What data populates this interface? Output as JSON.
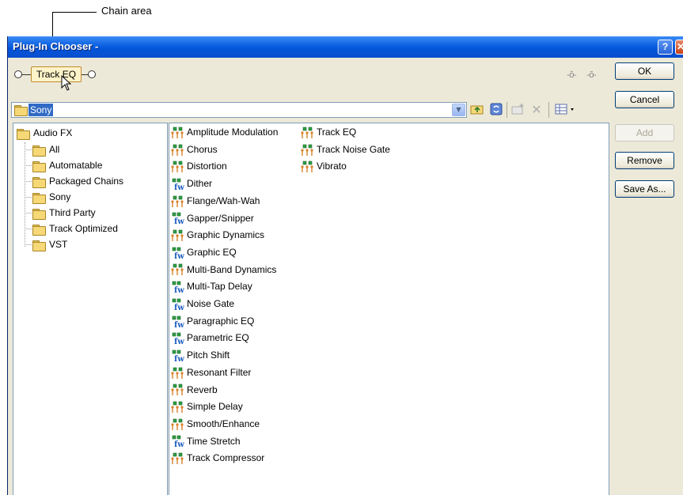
{
  "callout": {
    "text": "Chain area"
  },
  "window": {
    "title": "Plug-In Chooser -",
    "help_glyph": "?",
    "close_glyph": "✕"
  },
  "chain": {
    "item_label": "Track EQ"
  },
  "folder_selector": {
    "value": "Sony"
  },
  "buttons": {
    "ok": "OK",
    "cancel": "Cancel",
    "add": "Add",
    "remove": "Remove",
    "save_as": "Save As..."
  },
  "tree": {
    "root": "Audio FX",
    "children": [
      "All",
      "Automatable",
      "Packaged Chains",
      "Sony",
      "Third Party",
      "Track Optimized",
      "VST"
    ]
  },
  "plugins": [
    {
      "name": "Amplitude Modulation",
      "icon": "plugin-chain-icon"
    },
    {
      "name": "Chorus",
      "icon": "plugin-chain-icon"
    },
    {
      "name": "Distortion",
      "icon": "plugin-chain-icon"
    },
    {
      "name": "Dither",
      "icon": "plugin-fw-icon"
    },
    {
      "name": "Flange/Wah-Wah",
      "icon": "plugin-chain-icon"
    },
    {
      "name": "Gapper/Snipper",
      "icon": "plugin-fw-icon"
    },
    {
      "name": "Graphic Dynamics",
      "icon": "plugin-chain-icon"
    },
    {
      "name": "Graphic EQ",
      "icon": "plugin-fw-icon"
    },
    {
      "name": "Multi-Band Dynamics",
      "icon": "plugin-chain-icon"
    },
    {
      "name": "Multi-Tap Delay",
      "icon": "plugin-fw-icon"
    },
    {
      "name": "Noise Gate",
      "icon": "plugin-fw-icon"
    },
    {
      "name": "Paragraphic EQ",
      "icon": "plugin-fw-icon"
    },
    {
      "name": "Parametric EQ",
      "icon": "plugin-fw-icon"
    },
    {
      "name": "Pitch Shift",
      "icon": "plugin-fw-icon"
    },
    {
      "name": "Resonant Filter",
      "icon": "plugin-chain-icon"
    },
    {
      "name": "Reverb",
      "icon": "plugin-chain-icon"
    },
    {
      "name": "Simple Delay",
      "icon": "plugin-chain-icon"
    },
    {
      "name": "Smooth/Enhance",
      "icon": "plugin-chain-icon"
    },
    {
      "name": "Time Stretch",
      "icon": "plugin-fw-icon"
    },
    {
      "name": "Track Compressor",
      "icon": "plugin-chain-icon"
    },
    {
      "name": "Track EQ",
      "icon": "plugin-chain-icon"
    },
    {
      "name": "Track Noise Gate",
      "icon": "plugin-chain-icon"
    },
    {
      "name": "Vibrato",
      "icon": "plugin-chain-icon"
    }
  ]
}
